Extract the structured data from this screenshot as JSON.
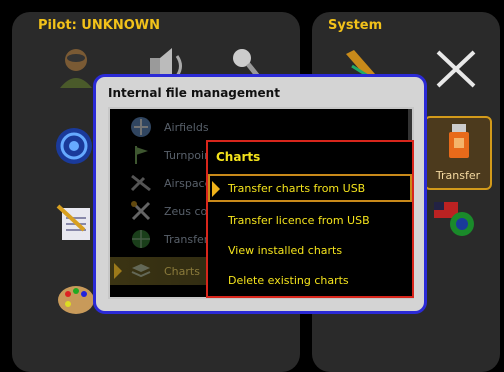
{
  "left_panel": {
    "title": "Pilot: UNKNOWN"
  },
  "right_panel": {
    "title": "System"
  },
  "transfer_tile": {
    "label": "Transfer",
    "icon": "usb-drive-icon"
  },
  "dialog": {
    "title": "Internal file management",
    "items": [
      {
        "label": "Airfields",
        "icon": "airfields-icon"
      },
      {
        "label": "Turnpoints",
        "icon": "turnpoint-flag-icon"
      },
      {
        "label": "Airspace",
        "icon": "airspace-icon"
      },
      {
        "label": "Zeus config",
        "icon": "tools-icon"
      },
      {
        "label": "Transfer",
        "icon": "globe-icon"
      },
      {
        "label": "Charts",
        "icon": "charts-icon",
        "selected": true
      }
    ]
  },
  "submenu": {
    "title": "Charts",
    "items": [
      {
        "label": "Transfer charts from USB",
        "selected": true
      },
      {
        "label": "Transfer licence from USB"
      },
      {
        "label": "View installed charts"
      },
      {
        "label": "Delete existing charts"
      }
    ]
  },
  "colors": {
    "accent": "#f2c21a",
    "dialog_border": "#2b2ad6",
    "submenu_border": "#d8261c",
    "submenu_text": "#f5e41c"
  }
}
